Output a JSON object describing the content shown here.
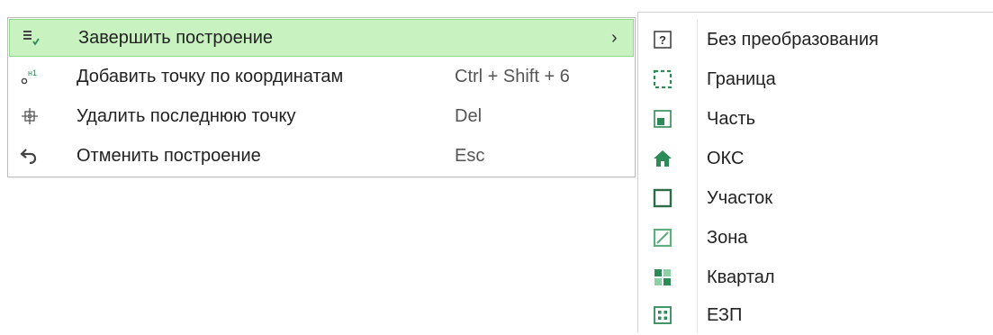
{
  "colors": {
    "accent_green": "#2e8b57",
    "highlight_bg": "#c9f2c1",
    "highlight_border": "#8fd98a",
    "icon_gray": "#555555"
  },
  "context_menu": {
    "items": [
      {
        "label": "Завершить построение",
        "shortcut": "",
        "has_submenu": true,
        "arrow": "›",
        "icon": "finish-construction-icon",
        "highlighted": true
      },
      {
        "label": "Добавить точку по координатам",
        "shortcut": "Ctrl + Shift + 6",
        "icon": "add-point-coordinates-icon"
      },
      {
        "label": "Удалить последнюю точку",
        "shortcut": "Del",
        "icon": "delete-last-point-icon"
      },
      {
        "label": "Отменить построение",
        "shortcut": "Esc",
        "icon": "undo-icon"
      }
    ],
    "icon_text": {
      "add_point": "н1"
    }
  },
  "submenu": {
    "items": [
      {
        "label": "Без преобразования",
        "icon": "question-box-icon",
        "icon_text": "?"
      },
      {
        "label": "Граница",
        "icon": "dashed-border-icon"
      },
      {
        "label": "Часть",
        "icon": "part-icon"
      },
      {
        "label": "ОКС",
        "icon": "house-icon"
      },
      {
        "label": "Участок",
        "icon": "plot-square-icon"
      },
      {
        "label": "Зона",
        "icon": "zone-icon"
      },
      {
        "label": "Квартал",
        "icon": "quarter-icon"
      },
      {
        "label": "ЕЗП",
        "icon": "ezp-icon"
      }
    ]
  }
}
